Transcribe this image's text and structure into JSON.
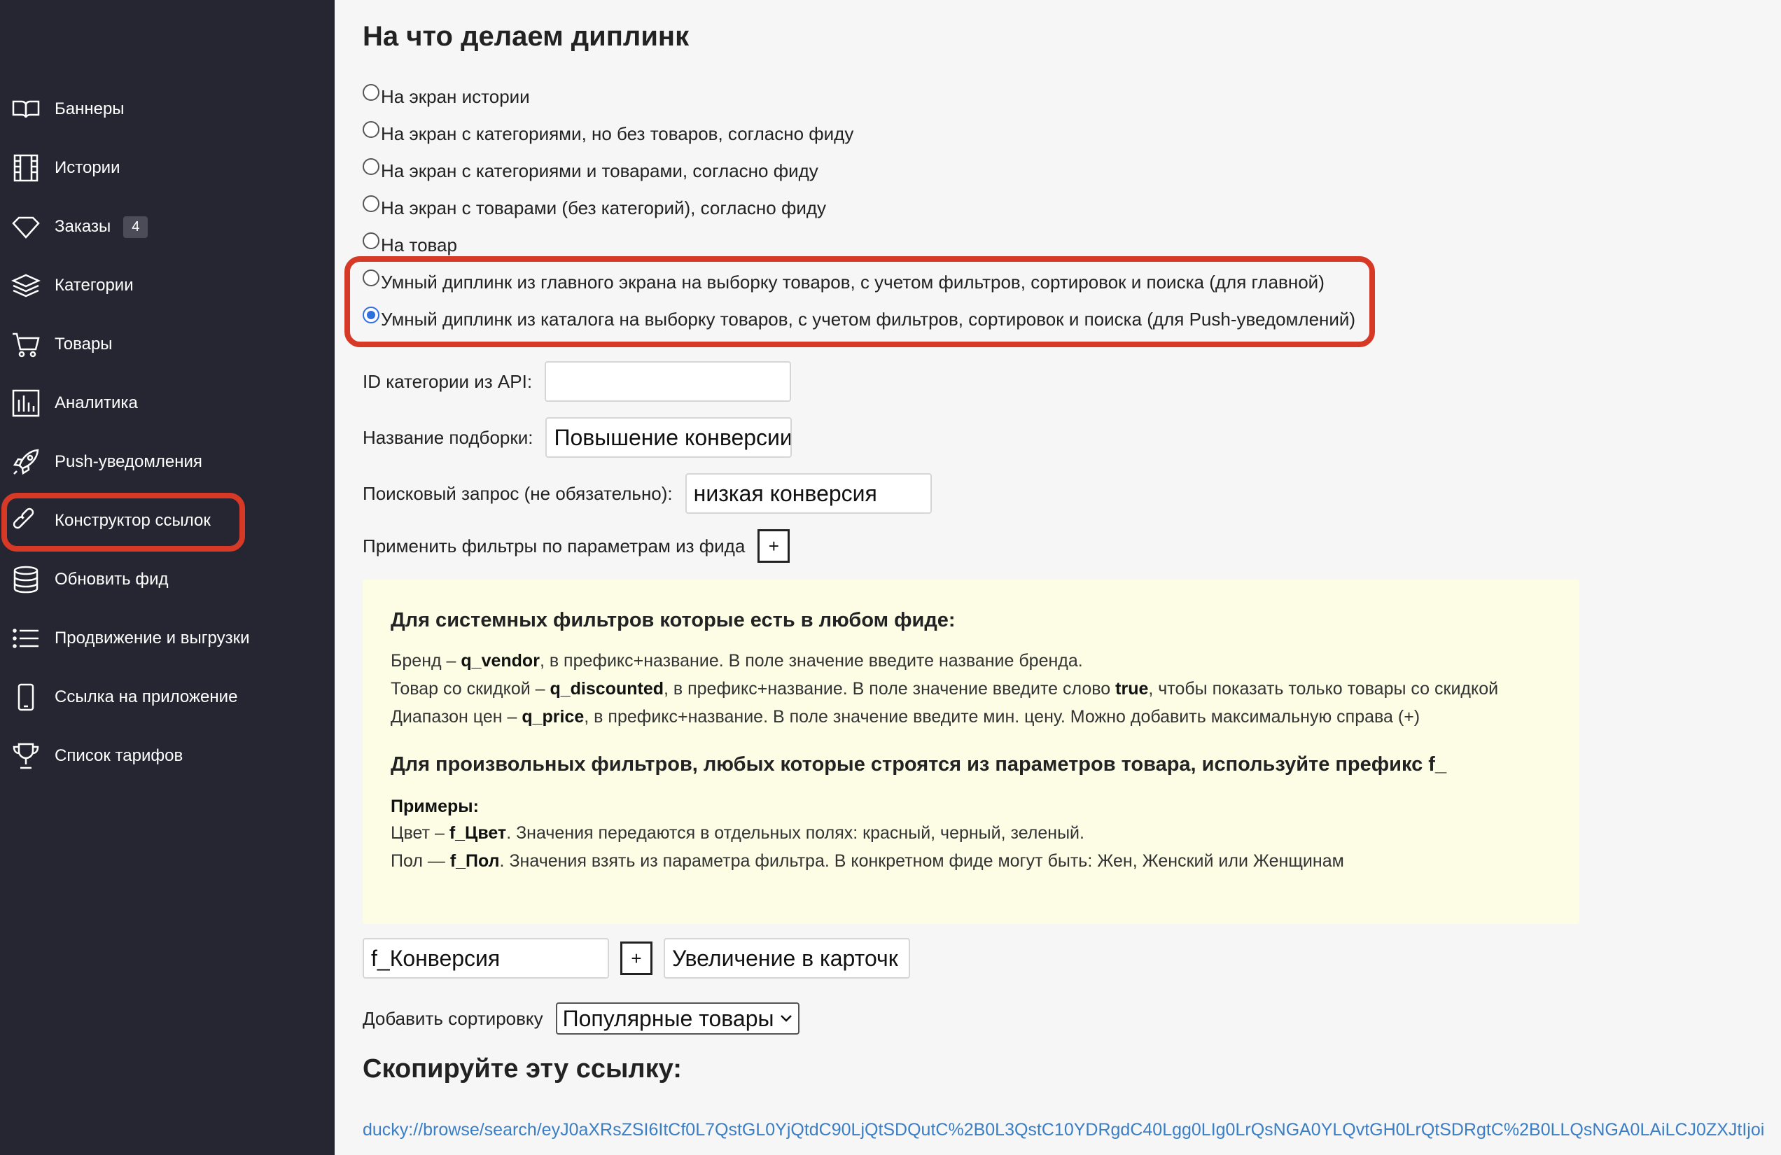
{
  "sidebar": {
    "items": [
      {
        "label": "Баннеры",
        "icon": "book-icon"
      },
      {
        "label": "Истории",
        "icon": "film-icon"
      },
      {
        "label": "Заказы",
        "icon": "tag-icon",
        "badge": "4"
      },
      {
        "label": "Категории",
        "icon": "layers-icon"
      },
      {
        "label": "Товары",
        "icon": "cart-icon"
      },
      {
        "label": "Аналитика",
        "icon": "analytics-icon"
      },
      {
        "label": "Push-уведомления",
        "icon": "rocket-icon"
      },
      {
        "label": "Конструктор ссылок",
        "icon": "link-icon",
        "active": true
      },
      {
        "label": "Обновить фид",
        "icon": "database-icon"
      },
      {
        "label": "Продвижение и выгрузки",
        "icon": "list-icon"
      },
      {
        "label": "Ссылка на приложение",
        "icon": "phone-icon"
      },
      {
        "label": "Список тарифов",
        "icon": "trophy-icon"
      }
    ]
  },
  "main": {
    "title": "На что делаем диплинк",
    "options": [
      {
        "label": "На экран истории",
        "checked": false
      },
      {
        "label": "На экран с категориями, но без товаров, согласно фиду",
        "checked": false
      },
      {
        "label": "На экран с категориями и товарами, согласно фиду",
        "checked": false
      },
      {
        "label": "На экран с товарами (без категорий), согласно фиду",
        "checked": false
      },
      {
        "label": "На товар",
        "checked": false
      },
      {
        "label": "Умный диплинк из главного экрана на выборку товаров, с учетом фильтров, сортировок и поиска (для главной)",
        "checked": false
      },
      {
        "label": "Умный диплинк из каталога на выборку товаров, с учетом фильтров, сортировок и поиска (для Push-уведомлений)",
        "checked": true
      }
    ],
    "category_id": {
      "label": "ID категории из API:",
      "value": ""
    },
    "collection_name": {
      "label": "Название подборки:",
      "value": "Повышение конверсии"
    },
    "search_query": {
      "label": "Поисковый запрос (не обязательно):",
      "value": "низкая конверсия"
    },
    "filters": {
      "label": "Применить фильтры по параметрам из фида",
      "add_label": "+"
    },
    "info": {
      "heading1": "Для системных фильтров которые есть в любом фиде:",
      "brand": {
        "pre": "Бренд – ",
        "key": "q_vendor",
        "post": ", в префикс+название. В поле значение введите название бренда."
      },
      "discount": {
        "pre": "Товар со скидкой – ",
        "key": "q_discounted",
        "mid": ", в префикс+название. В поле значение введите слово ",
        "word": "true",
        "post": ", чтобы показать только товары со скидкой"
      },
      "price": {
        "pre": "Диапазон цен – ",
        "key": "q_price",
        "post": ", в префикс+название. В поле значение введите мин. цену. Можно добавить максимальную справа (+)"
      },
      "heading2": "Для произвольных фильтров, любых которые строятся из параметров товара, используйте префикс f_",
      "examples_label": "Примеры:",
      "color": {
        "pre": "Цвет – ",
        "key": "f_Цвет",
        "post": ". Значения передаются в отдельных полях: красный, черный, зеленый."
      },
      "gender": {
        "pre": "Пол — ",
        "key": "f_Пол",
        "post": ". Значения взять из параметра фильтра. В конкретном фиде могут быть: Жен, Женский или Женщинам"
      }
    },
    "filter_row": {
      "name_value": "f_Конверсия",
      "add_label": "+",
      "value_value": "Увеличение в карточк"
    },
    "sort": {
      "label": "Добавить сортировку",
      "selected": "Популярные товары"
    },
    "copy_title": "Скопируйте эту ссылку:",
    "link": "ducky://browse/search/eyJ0aXRsZSI6ItCf0L7QstGL0YjQtdC90LjQtSDQutC%2B0L3QstC10YDRgdC40Lgg0LIg0LrQsNGA0YLQvtGH0LrQtSDRgtC%2B0LLQsNGA0LAiLCJ0ZXJtIjoi"
  },
  "colors": {
    "sidebar_bg": "#252632",
    "highlight": "#d63a26",
    "link": "#3a7ec6",
    "info_bg": "#fdfde6"
  }
}
